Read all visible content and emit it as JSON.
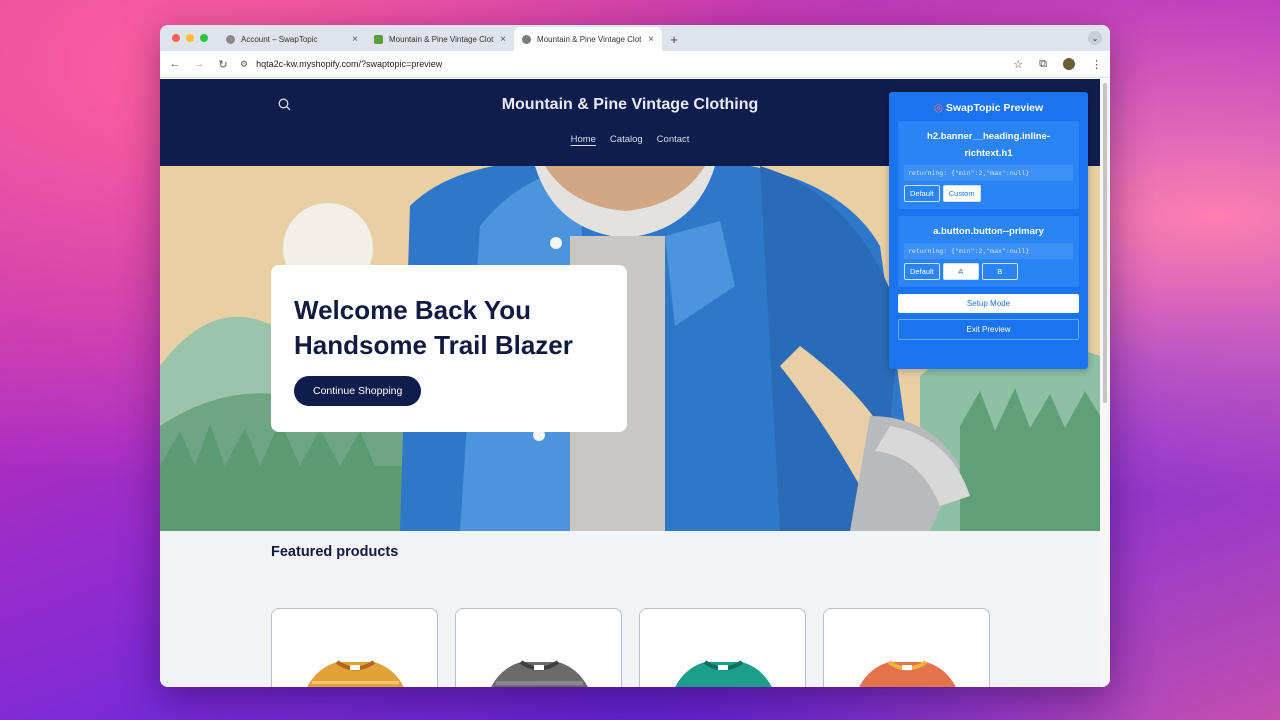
{
  "browser": {
    "tabs": [
      {
        "title": "Account – SwapTopic",
        "active": false
      },
      {
        "title": "Mountain & Pine Vintage Clot",
        "active": false
      },
      {
        "title": "Mountain & Pine Vintage Clot",
        "active": true
      }
    ],
    "new_tab_label": "+",
    "url": "hqta2c-kw.myshopify.com/?swaptopic=preview"
  },
  "site": {
    "title": "Mountain & Pine Vintage Clothing",
    "nav": [
      "Home",
      "Catalog",
      "Contact"
    ]
  },
  "hero": {
    "heading_line1": "Welcome Back You",
    "heading_line2": "Handsome Trail Blazer",
    "button_label": "Continue Shopping"
  },
  "featured": {
    "heading": "Featured products",
    "shirt_colors": [
      "#e2a23a",
      "#6b6b6b",
      "#1c9e8a",
      "#e4724a"
    ]
  },
  "swaptopic": {
    "title": "SwapTopic Preview",
    "blocks": [
      {
        "selector": "h2.banner__heading.inline-richtext.h1",
        "returning": "returning: {\"min\":2,\"max\":null}",
        "options": [
          "Default",
          "Custom"
        ],
        "selected": "Custom"
      },
      {
        "selector": "a.button.button--primary",
        "returning": "returning: {\"min\":2,\"max\":null}",
        "options": [
          "Default",
          "A",
          "B"
        ],
        "selected": "A"
      }
    ],
    "setup_label": "Setup Mode",
    "exit_label": "Exit Preview"
  },
  "colors": {
    "header_navy": "#0f1d4d",
    "panel_blue": "#1a73ef"
  }
}
